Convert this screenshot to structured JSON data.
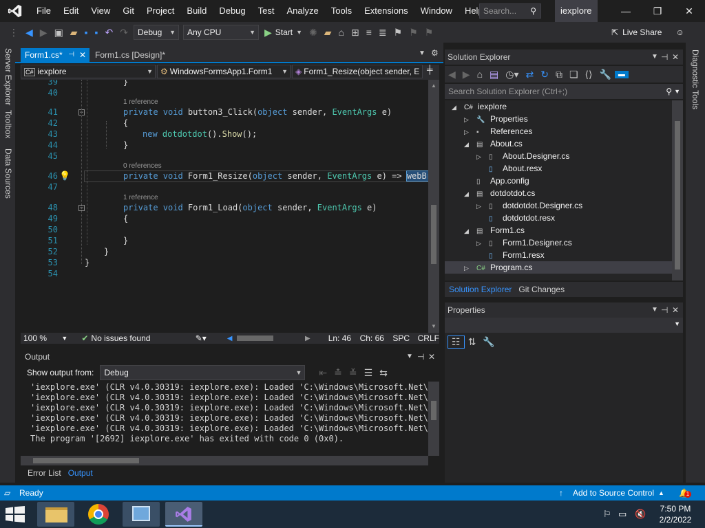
{
  "menu": [
    "File",
    "Edit",
    "View",
    "Git",
    "Project",
    "Build",
    "Debug",
    "Test",
    "Analyze",
    "Tools",
    "Extensions",
    "Window",
    "Help"
  ],
  "search_placeholder": "Search...",
  "window_title": "iexplore",
  "toolbar": {
    "config": "Debug",
    "platform": "Any CPU",
    "start_label": "Start",
    "live_share": "Live Share"
  },
  "left_strips": [
    "Server Explorer",
    "Toolbox",
    "Data Sources"
  ],
  "right_strip": "Diagnostic Tools",
  "editor": {
    "tabs": [
      {
        "label": "Form1.cs*",
        "active": true
      },
      {
        "label": "Form1.cs [Design]*",
        "active": false
      }
    ],
    "nav": {
      "project": "iexplore",
      "class": "WindowsFormsApp1.Form1",
      "member": "Form1_Resize(object sender, E"
    },
    "line_numbers": [
      "39",
      "40",
      "41",
      "42",
      "43",
      "44",
      "45",
      "46",
      "47",
      "48",
      "49",
      "50",
      "51",
      "52",
      "53",
      "54"
    ],
    "code": {
      "l39": "}",
      "ref1": "1 reference",
      "l41_a": "private ",
      "l41_b": "void ",
      "l41_c": "button3_Click(",
      "l41_d": "object ",
      "l41_e": "sender, ",
      "l41_f": "EventArgs ",
      "l41_g": "e)",
      "l42": "{",
      "l43_a": "new ",
      "l43_b": "dotdotdot",
      "l43_c": "().",
      "l43_d": "Show",
      "l43_e": "();",
      "l44": "}",
      "ref2": "0 references",
      "l46_a": "private ",
      "l46_b": "void ",
      "l46_c": "Form1_Resize(",
      "l46_d": "object ",
      "l46_e": "sender, ",
      "l46_f": "EventArgs ",
      "l46_g": "e) => ",
      "l46_h": "webBro",
      "ref3": "1 reference",
      "l48_a": "private ",
      "l48_b": "void ",
      "l48_c": "Form1_Load(",
      "l48_d": "object ",
      "l48_e": "sender, ",
      "l48_f": "EventArgs ",
      "l48_g": "e)",
      "l49": "{",
      "l51": "}",
      "l52": "}",
      "l53": "}"
    },
    "status": {
      "zoom": "100 %",
      "issues": "No issues found",
      "line": "Ln: 46",
      "col": "Ch: 66",
      "spc": "SPC",
      "eol": "CRLF"
    }
  },
  "output": {
    "title": "Output",
    "show_from_label": "Show output from:",
    "show_from_value": "Debug",
    "lines": [
      "'iexplore.exe' (CLR v4.0.30319: iexplore.exe): Loaded 'C:\\Windows\\Microsoft.Net\\as",
      "'iexplore.exe' (CLR v4.0.30319: iexplore.exe): Loaded 'C:\\Windows\\Microsoft.Net\\as",
      "'iexplore.exe' (CLR v4.0.30319: iexplore.exe): Loaded 'C:\\Windows\\Microsoft.Net\\as",
      "'iexplore.exe' (CLR v4.0.30319: iexplore.exe): Loaded 'C:\\Windows\\Microsoft.Net\\as",
      "'iexplore.exe' (CLR v4.0.30319: iexplore.exe): Loaded 'C:\\Windows\\Microsoft.Net\\as",
      "The program '[2692] iexplore.exe' has exited with code 0 (0x0)."
    ],
    "tabs": [
      "Error List",
      "Output"
    ]
  },
  "solution_explorer": {
    "title": "Solution Explorer",
    "search_placeholder": "Search Solution Explorer (Ctrl+;)",
    "items": [
      {
        "label": "iexplore",
        "icon": "csharp-project-icon",
        "expander": "◢"
      },
      {
        "label": "Properties",
        "icon": "wrench-icon",
        "expander": "▷"
      },
      {
        "label": "References",
        "icon": "references-icon",
        "expander": "▷"
      },
      {
        "label": "About.cs",
        "icon": "form-icon",
        "expander": "◢"
      },
      {
        "label": "About.Designer.cs",
        "icon": "cs-file-icon",
        "expander": "▷"
      },
      {
        "label": "About.resx",
        "icon": "resx-file-icon",
        "expander": ""
      },
      {
        "label": "App.config",
        "icon": "config-file-icon",
        "expander": ""
      },
      {
        "label": "dotdotdot.cs",
        "icon": "form-icon",
        "expander": "◢"
      },
      {
        "label": "dotdotdot.Designer.cs",
        "icon": "cs-file-icon",
        "expander": "▷"
      },
      {
        "label": "dotdotdot.resx",
        "icon": "resx-file-icon",
        "expander": ""
      },
      {
        "label": "Form1.cs",
        "icon": "form-icon",
        "expander": "◢"
      },
      {
        "label": "Form1.Designer.cs",
        "icon": "cs-file-icon",
        "expander": "▷"
      },
      {
        "label": "Form1.resx",
        "icon": "resx-file-icon",
        "expander": ""
      },
      {
        "label": "Program.cs",
        "icon": "csharp-file-icon",
        "expander": "▷"
      }
    ],
    "tabs": [
      "Solution Explorer",
      "Git Changes"
    ]
  },
  "properties": {
    "title": "Properties"
  },
  "statusbar": {
    "ready": "Ready",
    "source_control": "Add to Source Control",
    "notifications": "1"
  },
  "taskbar": {
    "time": "7:50 PM",
    "date": "2/2/2022"
  },
  "colors": {
    "accent": "#007acc",
    "keyword": "#569cd6",
    "type": "#4ec9b0",
    "linenum": "#2b91af"
  }
}
